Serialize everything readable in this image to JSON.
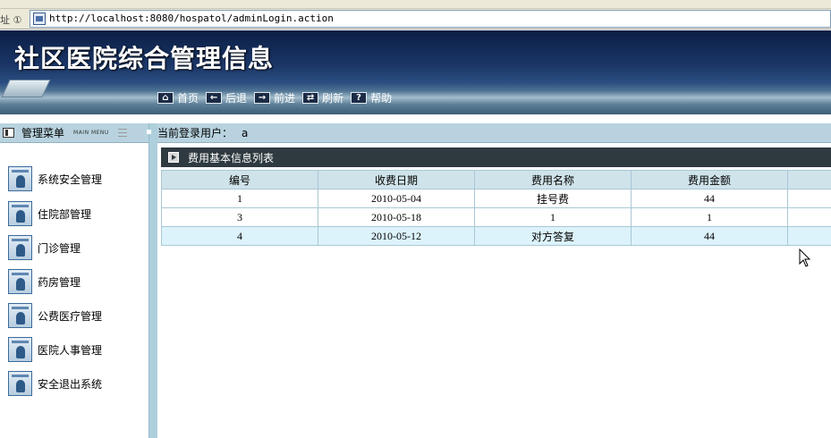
{
  "browser": {
    "address_label": "址 ①",
    "url": "http://localhost:8080/hospatol/adminLogin.action"
  },
  "header": {
    "title": "社区医院综合管理信息",
    "nav": [
      {
        "label": "首页",
        "icon": "home-icon"
      },
      {
        "label": "后退",
        "icon": "back-arrow-icon"
      },
      {
        "label": "前进",
        "icon": "forward-arrow-icon"
      },
      {
        "label": "刷新",
        "icon": "refresh-icon"
      },
      {
        "label": "帮助",
        "icon": "help-icon"
      }
    ]
  },
  "sidebar": {
    "title": "管理菜单",
    "subtitle": "MAIN MENU",
    "items": [
      {
        "label": "系统安全管理"
      },
      {
        "label": "住院部管理"
      },
      {
        "label": "门诊管理"
      },
      {
        "label": "药房管理"
      },
      {
        "label": "公费医疗管理"
      },
      {
        "label": "医院人事管理"
      },
      {
        "label": "安全退出系统"
      }
    ]
  },
  "userbar": {
    "label": "当前登录用户：",
    "value": "a"
  },
  "content": {
    "title": "费用基本信息列表",
    "columns": [
      "编号",
      "收费日期",
      "费用名称",
      "费用金额",
      ""
    ],
    "rows": [
      [
        "1",
        "2010-05-04",
        "挂号费",
        "44",
        ""
      ],
      [
        "3",
        "2010-05-18",
        "1",
        "1",
        ""
      ],
      [
        "4",
        "2010-05-12",
        "对方答复",
        "44",
        ""
      ]
    ]
  },
  "colors": {
    "banner_dark": "#0b1f45",
    "panel_bar": "#b8d3df",
    "list_header": "#2e3a40",
    "table_border": "#a9c7d5",
    "highlight_row": "#dcf3fb"
  }
}
